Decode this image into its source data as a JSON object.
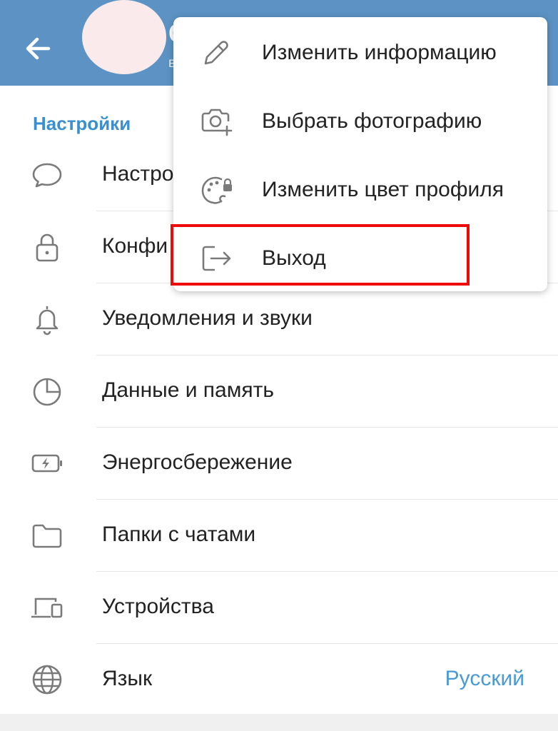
{
  "header": {
    "title_fragment": "С",
    "subtitle_fragment": "в"
  },
  "settings": {
    "section_title": "Настройки",
    "items": [
      {
        "label": "Настро",
        "icon": "chat-bubble-icon"
      },
      {
        "label": "Конфи",
        "icon": "lock-icon"
      },
      {
        "label": "Уведомления и звуки",
        "icon": "bell-icon"
      },
      {
        "label": "Данные и память",
        "icon": "pie-chart-icon"
      },
      {
        "label": "Энергосбережение",
        "icon": "battery-bolt-icon"
      },
      {
        "label": "Папки с чатами",
        "icon": "folder-icon"
      },
      {
        "label": "Устройства",
        "icon": "devices-icon"
      },
      {
        "label": "Язык",
        "icon": "globe-icon",
        "value": "Русский"
      }
    ]
  },
  "menu": {
    "items": [
      {
        "label": "Изменить информацию",
        "icon": "pencil-icon"
      },
      {
        "label": "Выбрать фотографию",
        "icon": "camera-add-icon"
      },
      {
        "label": "Изменить цвет профиля",
        "icon": "palette-lock-icon"
      },
      {
        "label": "Выход",
        "icon": "logout-icon"
      }
    ]
  },
  "colors": {
    "header": "#5c93c4",
    "accent": "#3a8fcf",
    "highlight_border": "#ee0a0a"
  }
}
